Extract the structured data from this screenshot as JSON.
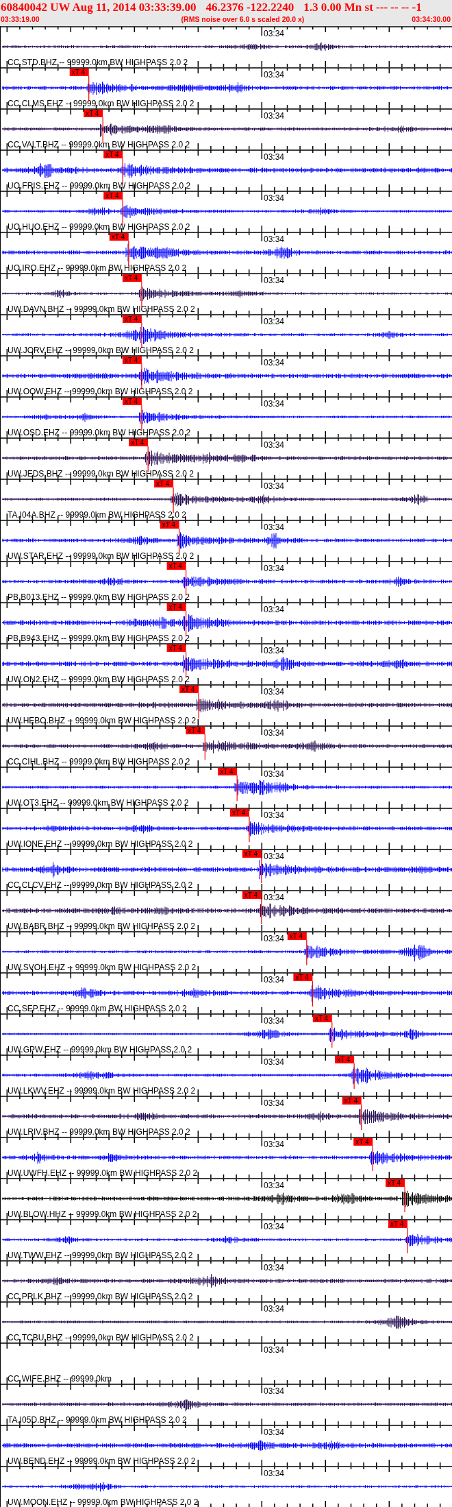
{
  "header": {
    "title_parts": [
      "60840042 UW Aug 11, 2014 03:33:39.00",
      "46.2376 -122.2240",
      "1.3 0.00 Mn st --- -- --  -1"
    ],
    "start_time": "03:33:19.00",
    "note": "(RMS noise over 6.0 s scaled 20.0 x)",
    "end_time": "03:34:30.00"
  },
  "traces": [
    {
      "label": "CC.STD.BHZ -- 99999.0km BW HIGHPASS 2.0 2",
      "time_label": "03:34",
      "color": "#240c50"
    },
    {
      "label": "CC.CLMS.EHZ -- 99999.0km BW HIGHPASS 2.0 2",
      "time_label": "03:34",
      "color": "#0000ff",
      "pick": {
        "label": "xT 4",
        "level": 0.195
      }
    },
    {
      "label": "CC.VALT.BHZ -- 99999.0km BW HIGHPASS 2.0 2",
      "time_label": "03:34",
      "color": "#240c50",
      "pick": {
        "label": "xT 4",
        "level": 0.226
      }
    },
    {
      "label": "UO.FRIS.EHZ -- 99999.0km BW HIGHPASS 2.0 2",
      "time_label": "03:34",
      "color": "#0000ff",
      "pick": {
        "label": "xT 4",
        "level": 0.27
      }
    },
    {
      "label": "UO.HUO.EHZ -- 99999.0km BW HIGHPASS 2.0 2",
      "time_label": "03:34",
      "color": "#0000ff",
      "pick": {
        "label": "xT 4",
        "level": 0.27
      }
    },
    {
      "label": "UO.IRO.EHZ -- 99999.0km BW HIGHPASS 2.0 2",
      "time_label": "03:34",
      "color": "#0000ff",
      "pick": {
        "label": "xT 4",
        "level": 0.283
      }
    },
    {
      "label": "UW.DAVN.BHZ -- 99999.0km BW HIGHPASS 2.0 2",
      "time_label": "03:34",
      "color": "#240c50",
      "pick": {
        "label": "xT 4",
        "level": 0.312
      }
    },
    {
      "label": "UW.JORV.EHZ -- 99999.0km BW HIGHPASS 2.0 2",
      "time_label": "03:34",
      "color": "#0000ff",
      "pick": {
        "label": "xT 4",
        "level": 0.312
      }
    },
    {
      "label": "UW.OOW.EHZ -- 99999.0km BW HIGHPASS 2.0 2",
      "time_label": "03:34",
      "color": "#0000ff",
      "pick": {
        "label": "xT 4",
        "level": 0.312
      }
    },
    {
      "label": "UW.OSD.EHZ -- 99999.0km BW HIGHPASS 2.0 2",
      "time_label": "03:34",
      "color": "#0000ff",
      "pick": {
        "label": "xT 4",
        "level": 0.312
      }
    },
    {
      "label": "UW.JEDS.BHZ -- 99999.0km BW HIGHPASS 2.0 2",
      "time_label": "03:34",
      "color": "#240c50",
      "pick": {
        "label": "xT 4",
        "level": 0.326
      }
    },
    {
      "label": "TA.I04A.BHZ -- 99999.0km BW HIGHPASS 2.0 2",
      "time_label": "03:34",
      "color": "#240c50",
      "pick": {
        "label": "xT 4",
        "level": 0.382
      }
    },
    {
      "label": "UW.STAR.EHZ -- 99999.0km BW HIGHPASS 2.0 2",
      "time_label": "03:34",
      "color": "#0000ff",
      "pick": {
        "label": "xT 4",
        "level": 0.395
      }
    },
    {
      "label": "PB.B013.EHZ -- 99999.0km BW HIGHPASS 2.0 2",
      "time_label": "03:34",
      "color": "#0000ff",
      "pick": {
        "label": "xT 4",
        "level": 0.41
      }
    },
    {
      "label": "PB.B943.EHZ -- 99999.0km BW HIGHPASS 2.0 2",
      "time_label": "03:34",
      "color": "#0000ff",
      "pick": {
        "label": "xT 4",
        "level": 0.41
      }
    },
    {
      "label": "UW.ON2.EHZ -- 99999.0km BW HIGHPASS 2.0 2",
      "time_label": "03:34",
      "color": "#0000ff",
      "pick": {
        "label": "xT 4",
        "level": 0.41
      }
    },
    {
      "label": "UW.HEBO.BHZ -- 99999.0km BW HIGHPASS 2.0 2",
      "time_label": "03:34",
      "color": "#240c50",
      "pick": {
        "label": "xT 4",
        "level": 0.438
      }
    },
    {
      "label": "CC.CIHL.BHZ -- 99999.0km BW HIGHPASS 2.0 2",
      "time_label": "03:34",
      "color": "#240c50",
      "pick": {
        "label": "xT 4",
        "level": 0.452
      }
    },
    {
      "label": "UW.OT3.EHZ -- 99999.0km BW HIGHPASS 2.0 2",
      "time_label": "03:34",
      "color": "#0000ff",
      "pick": {
        "label": "xT 4",
        "level": 0.523
      }
    },
    {
      "label": "UW.IONE.EHZ -- 99999.0km BW HIGHPASS 2.0 2",
      "time_label": "03:34",
      "color": "#0000ff",
      "pick": {
        "label": "xT 4",
        "level": 0.55
      }
    },
    {
      "label": "CC.CLCV.EHZ -- 99999.0km BW HIGHPASS 2.0 2",
      "time_label": "03:34",
      "color": "#0000ff",
      "pick": {
        "label": "xT 4",
        "level": 0.577
      }
    },
    {
      "label": "UW.BABR.BHZ -- 99999.0km BW HIGHPASS 2.0 2",
      "time_label": "03:34",
      "color": "#240c50",
      "pick": {
        "label": "xT 4",
        "level": 0.577
      }
    },
    {
      "label": "UW.SVOH.EHZ -- 99999.0km BW HIGHPASS 2.0 2",
      "time_label": "03:34",
      "color": "#0000ff",
      "pick": {
        "label": "xT 4",
        "level": 0.677
      }
    },
    {
      "label": "CC.SEP.EHZ -- 99999.0km BW HIGHPASS 2.0 2",
      "time_label": "03:34",
      "color": "#0000ff",
      "pick": {
        "label": "xT 4",
        "level": 0.69
      }
    },
    {
      "label": "UW.GPW.EHZ -- 99999.0km BW HIGHPASS 2.0 2",
      "time_label": "03:34",
      "color": "#0000ff",
      "pick": {
        "label": "xT 4",
        "level": 0.733
      }
    },
    {
      "label": "UW.LKWV.EHZ -- 99999.0km BW HIGHPASS 2.0 2",
      "time_label": "03:34",
      "color": "#0000ff",
      "pick": {
        "label": "xT 4",
        "level": 0.782
      }
    },
    {
      "label": "UW.LRIV.BHZ -- 99999.0km BW HIGHPASS 2.0 2",
      "time_label": "03:34",
      "color": "#240c50",
      "pick": {
        "label": "xT 4",
        "level": 0.798
      }
    },
    {
      "label": "UW.UWFH.EHZ -- 99999.0km BW HIGHPASS 2.0 2",
      "time_label": "03:34",
      "color": "#0000ff",
      "pick": {
        "label": "xT 4",
        "level": 0.823
      }
    },
    {
      "label": "UW.BLOW.HHZ -- 99999.0km BW HIGHPASS 2.0 2",
      "time_label": "03:34",
      "color": "#000000",
      "pick": {
        "label": "xT 4",
        "level": 0.894
      }
    },
    {
      "label": "UW.TWW.EHZ -- 99999.0km BW HIGHPASS 2.0 2",
      "time_label": "03:34",
      "color": "#0000ff",
      "pick": {
        "label": "xT 4",
        "level": 0.9
      }
    },
    {
      "label": "CC.PRLK.BHZ -- 99999.0km BW HIGHPASS 2.0 2",
      "time_label": "03:34",
      "color": "#240c50"
    },
    {
      "label": "CC.TCBU.BHZ -- 99999.0km BW HIGHPASS 2.0 2",
      "time_label": "03:34",
      "color": "#240c50"
    },
    {
      "label": "CC.WIFE.BHZ -- 99999.0km",
      "time_label": "03:34"
    },
    {
      "label": "TA.I05D.BHZ -- 99999.0km BW HIGHPASS 2.0 2",
      "time_label": "03:34",
      "color": "#240c50"
    },
    {
      "label": "UW.BEND.EHZ -- 99999.0km BW HIGHPASS 2.0 2",
      "time_label": "03:34",
      "color": "#0000ff"
    },
    {
      "label": "UW.MOON.EHZ -- 99999.0km BW HIGHPASS 2.0 2",
      "time_label": "03:34",
      "color": "#0000ff"
    }
  ]
}
